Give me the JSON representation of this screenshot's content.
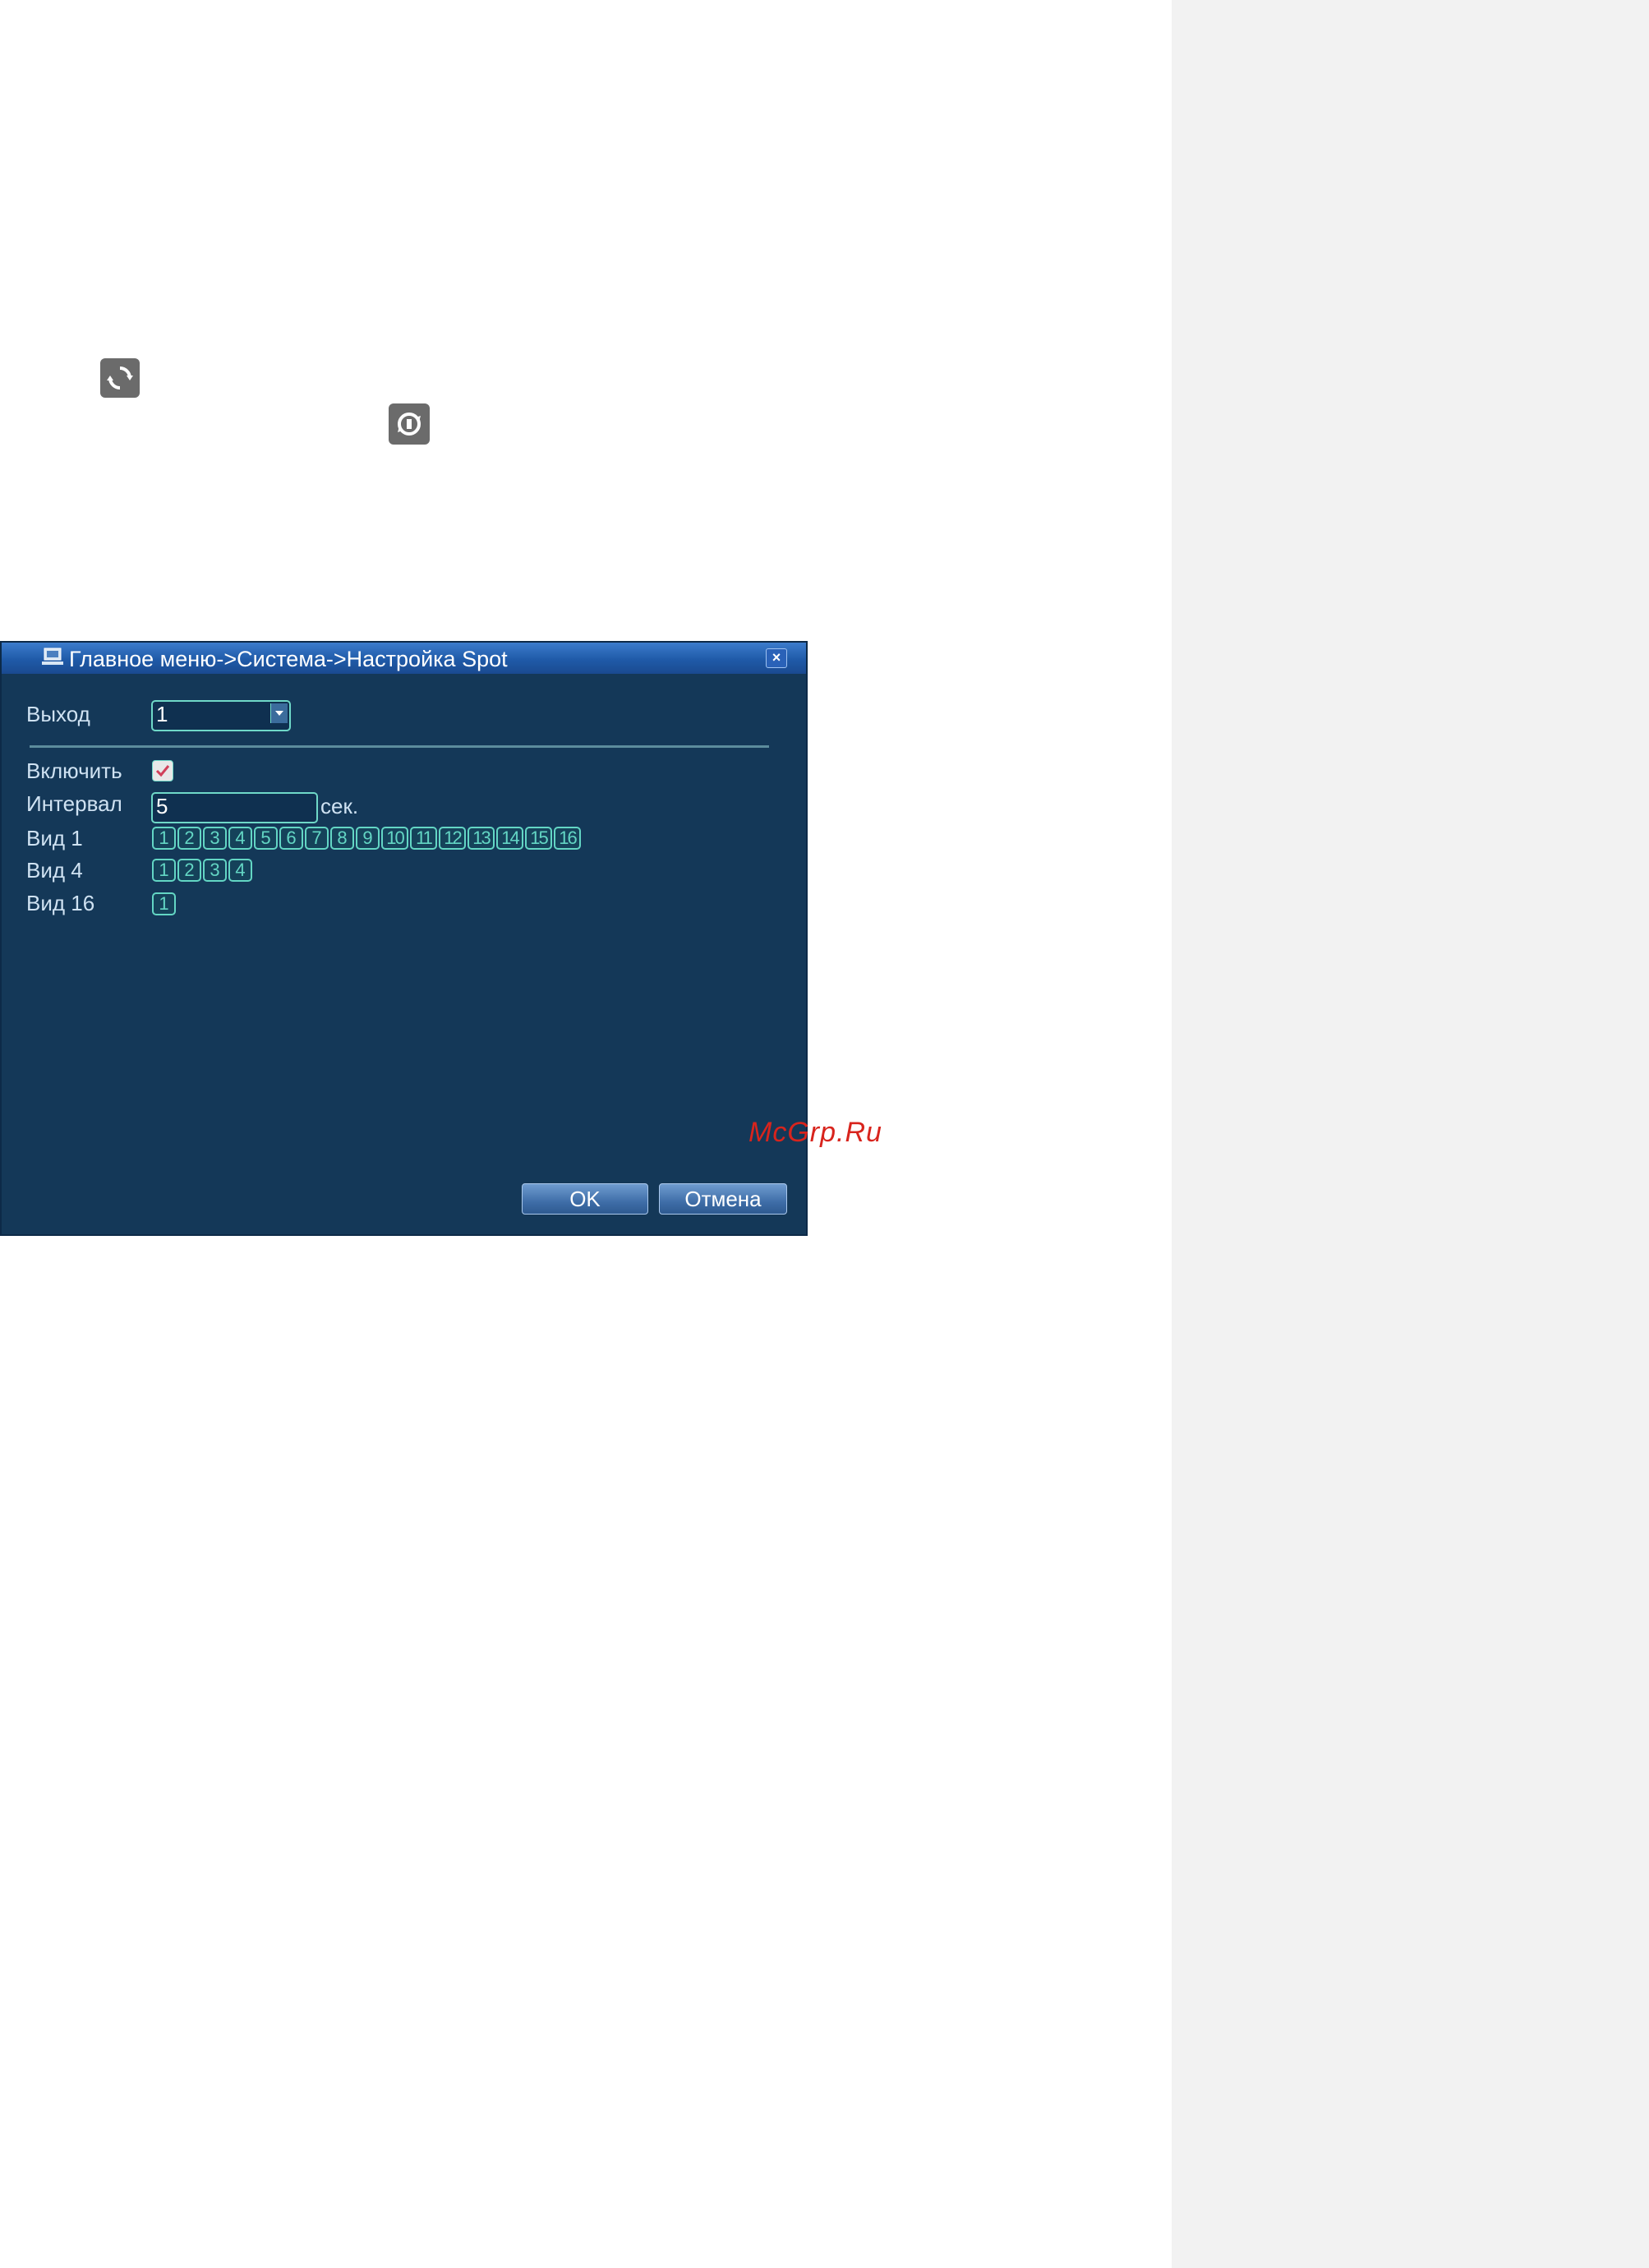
{
  "window": {
    "title": "Главное меню->Система->Настройка Spot",
    "close_label": "×"
  },
  "form": {
    "output_label": "Выход",
    "output_value": "1",
    "enable_label": "Включить",
    "enable_checked": true,
    "interval_label": "Интервал",
    "interval_value": "5",
    "interval_unit": "сек.",
    "view1_label": "Вид 1",
    "view1_channels": [
      "1",
      "2",
      "3",
      "4",
      "5",
      "6",
      "7",
      "8",
      "9",
      "10",
      "11",
      "12",
      "13",
      "14",
      "15",
      "16"
    ],
    "view4_label": "Вид 4",
    "view4_channels": [
      "1",
      "2",
      "3",
      "4"
    ],
    "view16_label": "Вид 16",
    "view16_channels": [
      "1"
    ]
  },
  "buttons": {
    "ok_label": "OK",
    "cancel_label": "Отмена"
  },
  "watermark": "McGrp.Ru",
  "icons": {
    "cycle_icon": "cycle-icon",
    "cycle_reset_icon": "cycle-reset-icon"
  },
  "colors": {
    "window_bg": "#143858",
    "title_bar": "#1f5aa8",
    "accent": "#63d6c4",
    "sidebar": "#f2f2f2",
    "watermark": "#d8241d"
  }
}
